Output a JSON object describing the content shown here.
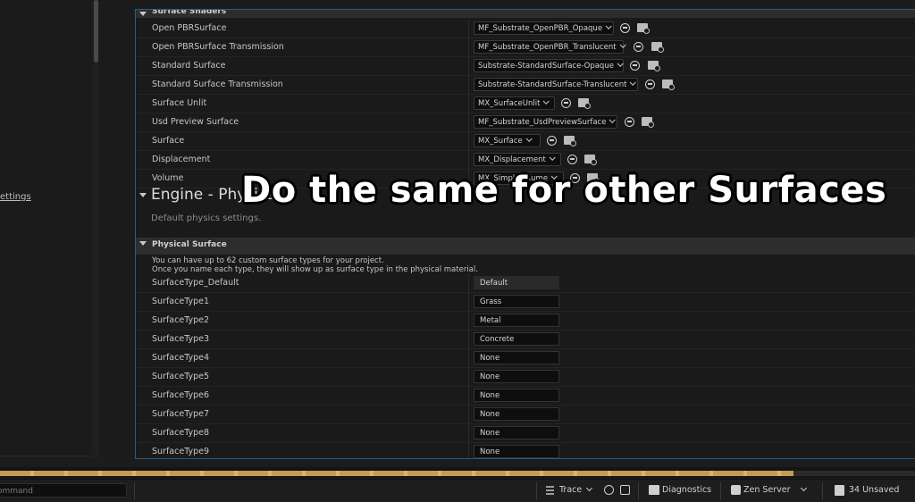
{
  "left_panel": {
    "settings_link": "ettings"
  },
  "surface_shaders": {
    "header": "Surface Shaders",
    "rows": [
      {
        "name": "Open PBRSurface",
        "value": "MF_Substrate_OpenPBR_Opaque"
      },
      {
        "name": "Open PBRSurface Transmission",
        "value": "MF_Substrate_OpenPBR_Translucent"
      },
      {
        "name": "Standard Surface",
        "value": "Substrate-StandardSurface-Opaque"
      },
      {
        "name": "Standard Surface Transmission",
        "value": "Substrate-StandardSurface-Translucent"
      },
      {
        "name": "Surface Unlit",
        "value": "MX_SurfaceUnlit"
      },
      {
        "name": "Usd Preview Surface",
        "value": "MF_Substrate_UsdPreviewSurface"
      },
      {
        "name": "Surface",
        "value": "MX_Surface"
      },
      {
        "name": "Displacement",
        "value": "MX_Displacement"
      },
      {
        "name": "Volume",
        "value": "MX_SimpleVolume"
      }
    ]
  },
  "engine_physics": {
    "title": "Engine - Physics",
    "description": "Default physics settings."
  },
  "physical_surface": {
    "header": "Physical Surface",
    "info_line1": "You can have up to 62 custom surface types for your project.",
    "info_line2": "Once you name each type, they will show up as surface type in the physical material.",
    "rows": [
      {
        "name": "SurfaceType_Default",
        "value": "Default"
      },
      {
        "name": "SurfaceType1",
        "value": "Grass"
      },
      {
        "name": "SurfaceType2",
        "value": "Metal"
      },
      {
        "name": "SurfaceType3",
        "value": "Concrete"
      },
      {
        "name": "SurfaceType4",
        "value": "None"
      },
      {
        "name": "SurfaceType5",
        "value": "None"
      },
      {
        "name": "SurfaceType6",
        "value": "None"
      },
      {
        "name": "SurfaceType7",
        "value": "None"
      },
      {
        "name": "SurfaceType8",
        "value": "None"
      },
      {
        "name": "SurfaceType9",
        "value": "None"
      }
    ]
  },
  "overlay": {
    "caption": "Do the same for other Surfaces"
  },
  "statusbar": {
    "command_placeholder": "ommand",
    "trace": "Trace",
    "diagnostics": "Diagnostics",
    "zen_server": "Zen Server",
    "unsaved": "34 Unsaved"
  },
  "icons": {
    "use_selected": "arrow-left-circle-icon",
    "browse": "folder-search-icon"
  }
}
